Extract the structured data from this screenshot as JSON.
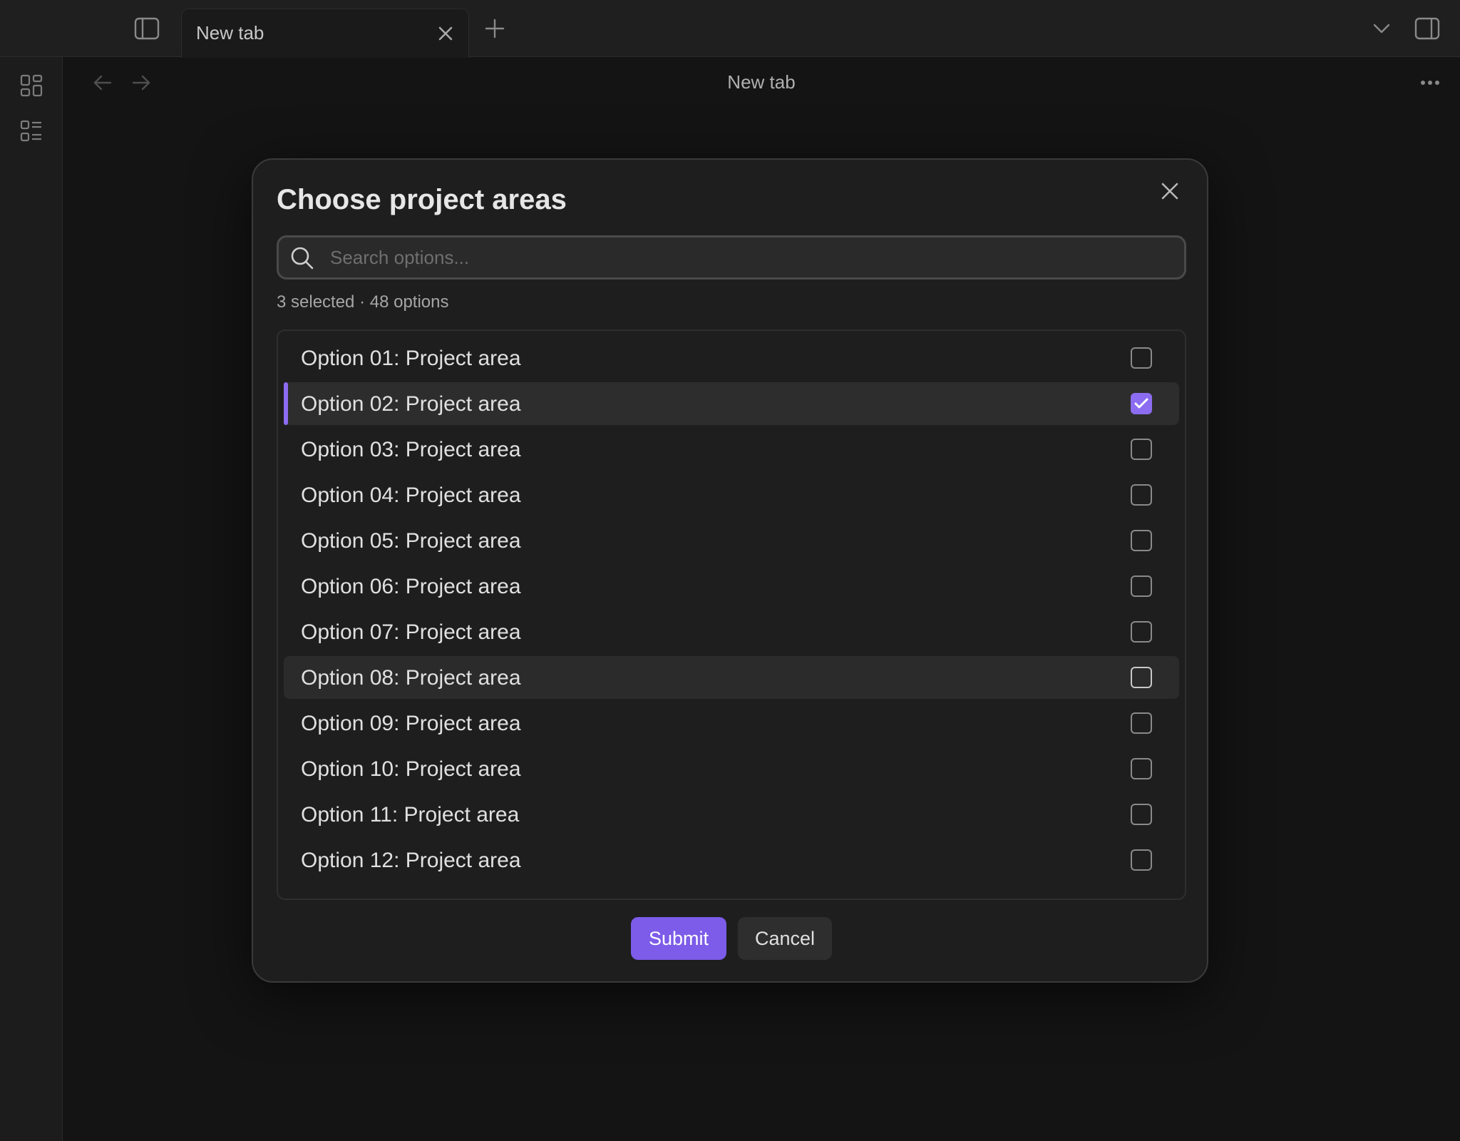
{
  "tabbar": {
    "tab_title": "New tab",
    "icons": {
      "sidebar_toggle": "sidebar-left-icon",
      "tab_close": "close-icon",
      "new_tab": "plus-icon",
      "tab_list": "chevron-down-icon",
      "right_sidebar_toggle": "sidebar-right-icon"
    }
  },
  "ribbon": {
    "icons": [
      "grid-layout-icon",
      "list-layout-icon"
    ]
  },
  "view_header": {
    "title": "New tab",
    "icons": {
      "back": "arrow-left-icon",
      "forward": "arrow-right-icon",
      "more": "more-horizontal-icon"
    }
  },
  "modal": {
    "title": "Choose project areas",
    "search": {
      "placeholder": "Search options...",
      "value": ""
    },
    "summary": "3 selected · 48 options",
    "options": [
      {
        "label": "Option 01: Project area",
        "checked": false
      },
      {
        "label": "Option 02: Project area",
        "checked": true
      },
      {
        "label": "Option 03: Project area",
        "checked": false
      },
      {
        "label": "Option 04: Project area",
        "checked": false
      },
      {
        "label": "Option 05: Project area",
        "checked": false
      },
      {
        "label": "Option 06: Project area",
        "checked": false
      },
      {
        "label": "Option 07: Project area",
        "checked": false
      },
      {
        "label": "Option 08: Project area",
        "checked": false
      },
      {
        "label": "Option 09: Project area",
        "checked": false
      },
      {
        "label": "Option 10: Project area",
        "checked": false
      },
      {
        "label": "Option 11: Project area",
        "checked": false
      },
      {
        "label": "Option 12: Project area",
        "checked": false
      }
    ],
    "submit_label": "Submit",
    "cancel_label": "Cancel"
  },
  "colors": {
    "accent": "#7c5ce8",
    "background": "#141414",
    "modal_background": "#1e1e1e"
  }
}
